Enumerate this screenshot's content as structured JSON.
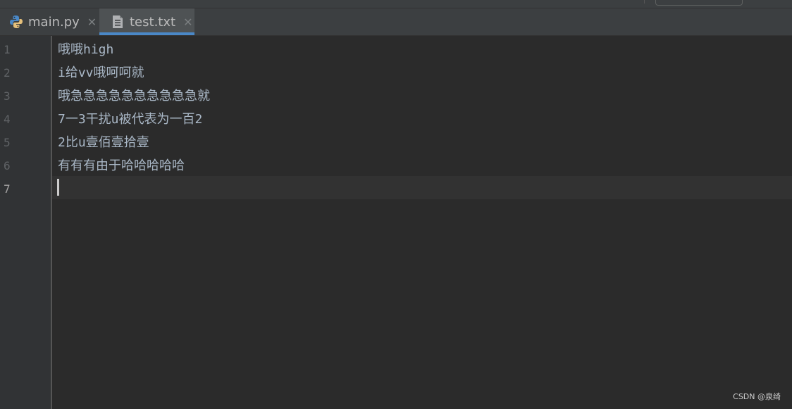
{
  "tabs": [
    {
      "label": "main.py",
      "icon": "python-file-icon",
      "close": "✕",
      "active": false
    },
    {
      "label": "test.txt",
      "icon": "text-file-icon",
      "close": "✕",
      "active": true
    }
  ],
  "editor": {
    "line_numbers": [
      "1",
      "2",
      "3",
      "4",
      "5",
      "6",
      "7"
    ],
    "current_line": 7,
    "lines": [
      "哦哦high",
      "i给vv哦呵呵就",
      "哦急急急急急急急急急急就",
      "7一3干扰u被代表为一百2",
      "2比u壹佰壹拾壹",
      "有有有由于哈哈哈哈哈",
      ""
    ]
  },
  "watermark": "CSDN @泉绮",
  "colors": {
    "background": "#2b2b2b",
    "gutter": "#313335",
    "tab_active_underline": "#4a88c7",
    "text": "#a9b7c6"
  }
}
